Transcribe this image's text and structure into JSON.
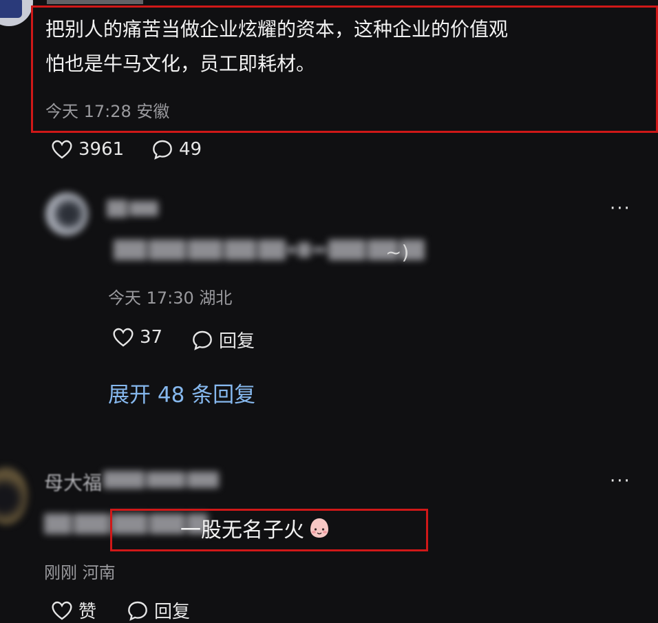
{
  "comment_main": {
    "text_line1": "把别人的痛苦当做企业炫耀的资本，这种企业的价值观",
    "text_line2": "怕也是牛马文化，员工即耗材。",
    "meta": "今天 17:28 安徽",
    "likes": "3961",
    "comments": "49"
  },
  "reply1": {
    "meta": "今天 17:30 湖北",
    "likes": "37",
    "reply_label": "回复",
    "more": "···",
    "text_tail": "~)"
  },
  "expand_replies": "展开 48 条回复",
  "comment2": {
    "name_visible": "母大福",
    "text_visible": "一股无名子火",
    "meta": "刚刚 河南",
    "like_label": "赞",
    "reply_label": "回复",
    "more": "···"
  },
  "colors": {
    "highlight": "#d01818",
    "link": "#86b8ee",
    "background": "#101012"
  }
}
